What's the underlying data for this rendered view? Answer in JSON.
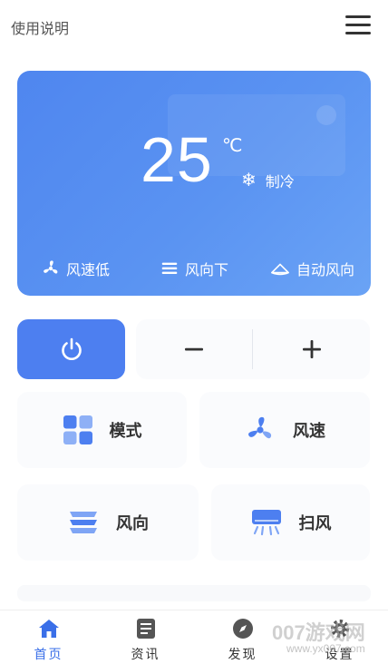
{
  "header": {
    "manual_link": "使用说明",
    "menu_icon": "hamburger-menu-icon"
  },
  "panel": {
    "temperature": "25",
    "unit": "℃",
    "mode_icon": "snowflake-icon",
    "mode_label": "制冷",
    "status": [
      {
        "icon": "fan-icon",
        "label": "风速低"
      },
      {
        "icon": "wind-direction-icon",
        "label": "风向下"
      },
      {
        "icon": "auto-swing-icon",
        "label": "自动风向"
      }
    ]
  },
  "controls": {
    "power_icon": "power-icon",
    "minus_symbol": "−",
    "plus_symbol": "+"
  },
  "functions": {
    "mode": "模式",
    "fan_speed": "风速",
    "direction": "风向",
    "swing": "扫风"
  },
  "bottom_nav": [
    {
      "label": "首页",
      "icon": "home-icon",
      "active": true
    },
    {
      "label": "资讯",
      "icon": "news-icon",
      "active": false
    },
    {
      "label": "发现",
      "icon": "compass-icon",
      "active": false
    },
    {
      "label": "设置",
      "icon": "settings-icon",
      "active": false
    }
  ],
  "watermark": {
    "text": "007游戏网",
    "url": "www.yx007.com"
  },
  "colors": {
    "accent": "#4d7ff0",
    "panel_gradient_start": "#4f86ef",
    "panel_gradient_end": "#6aa3f5"
  }
}
